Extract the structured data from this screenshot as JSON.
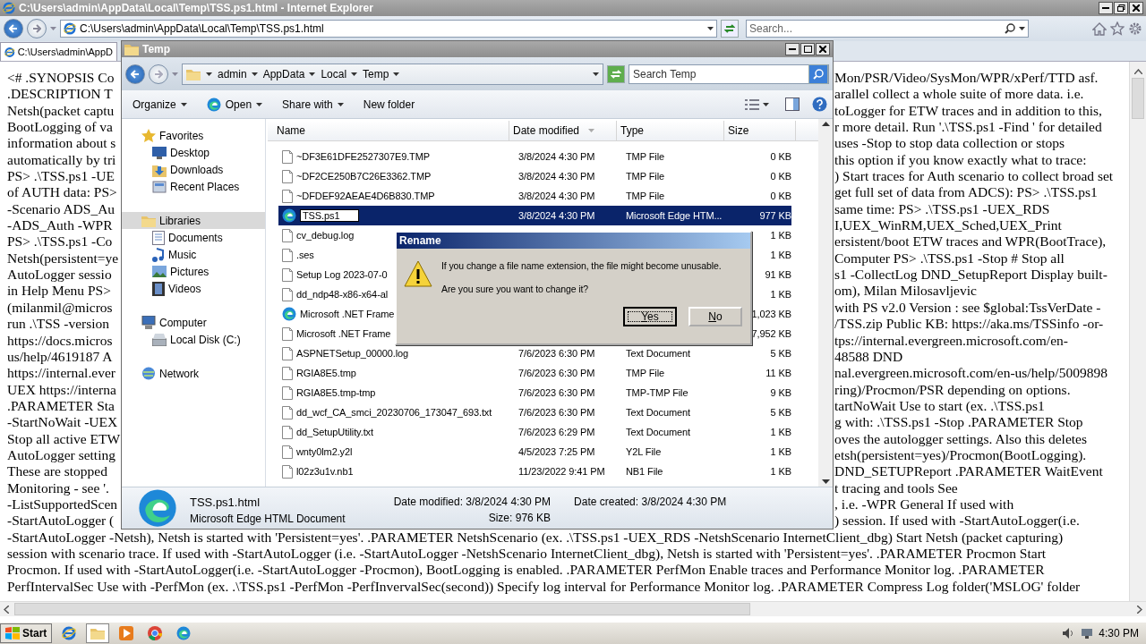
{
  "browser": {
    "title": "C:\\Users\\admin\\AppData\\Local\\Temp\\TSS.ps1.html - Internet Explorer",
    "address": "C:\\Users\\admin\\AppData\\Local\\Temp\\TSS.ps1.html",
    "search": {
      "placeholder": "Search..."
    },
    "tabs": [
      {
        "label": "C:\\Users\\admin\\AppD",
        "selected": true
      }
    ]
  },
  "page_text": {
    "split_lines": [
      {
        "left": "<# .SYNOPSIS Co",
        "right": "Mon/PSR/Video/SysMon/WPR/xPerf/TTD asf."
      },
      {
        "left": ".DESCRIPTION T",
        "right": "arallel collect a whole suite of more data. i.e."
      },
      {
        "left": "Netsh(packet captu",
        "right": "toLogger for ETW traces and in addition to this,"
      },
      {
        "left": "BootLogging of va",
        "right": "r more detail. Run '.\\TSS.ps1 -Find ' for detailed"
      },
      {
        "left": "information about s",
        "right": "uses -Stop to stop data collection or stops"
      },
      {
        "left": "automatically by tri",
        "right": "this option if you know exactly what to trace:"
      },
      {
        "left": "PS> .\\TSS.ps1 -UE",
        "right": ") Start traces for Auth scenario to collect broad set"
      },
      {
        "left": "of AUTH data: PS>",
        "right": "get full set of data from ADCS): PS> .\\TSS.ps1"
      },
      {
        "left": "-Scenario ADS_Au",
        "right": "same time: PS> .\\TSS.ps1 -UEX_RDS"
      },
      {
        "left": "-ADS_Auth -WPR",
        "right": "I,UEX_WinRM,UEX_Sched,UEX_Print"
      },
      {
        "left": "PS> .\\TSS.ps1 -Co",
        "right": "ersistent/boot ETW traces and WPR(BootTrace),"
      },
      {
        "left": "Netsh(persistent=ye",
        "right": "Computer PS> .\\TSS.ps1 -Stop # Stop all"
      },
      {
        "left": "AutoLogger sessio",
        "right": "s1 -CollectLog DND_SetupReport Display built-"
      },
      {
        "left": "in Help Menu PS>",
        "right": "om), Milan Milosavljevic"
      },
      {
        "left": "(milanmil@micros",
        "right": "with PS v2.0 Version : see $global:TssVerDate -"
      },
      {
        "left": "run .\\TSS -version",
        "right": "/TSS.zip Public KB: https://aka.ms/TSSinfo -or-"
      },
      {
        "left": "https://docs.micros",
        "right": "tps://internal.evergreen.microsoft.com/en-"
      },
      {
        "left": "us/help/4619187 A",
        "right": "48588 DND"
      },
      {
        "left": "https://internal.ever",
        "right": "nal.evergreen.microsoft.com/en-us/help/5009898"
      },
      {
        "left": "UEX https://interna",
        "right": "ring)/Procmon/PSR depending on options."
      },
      {
        "left": ".PARAMETER Sta",
        "right": "tartNoWait Use to start (ex. .\\TSS.ps1"
      },
      {
        "left": "-StartNoWait -UEX",
        "right": "g with: .\\TSS.ps1 -Stop .PARAMETER Stop"
      },
      {
        "left": "Stop all active ETW",
        "right": "oves the autologger settings. Also this deletes"
      },
      {
        "left": "AutoLogger setting",
        "right": "etsh(persistent=yes)/Procmon(BootLogging)."
      },
      {
        "left": "These are stopped",
        "right": "DND_SETUPReport .PARAMETER WaitEvent"
      },
      {
        "left": "Monitoring - see '.",
        "right": "t tracing and tools See"
      },
      {
        "left": "-ListSupportedScen",
        "right": ", i.e. -WPR General If used with"
      },
      {
        "left": "-StartAutoLogger (",
        "right": ") session. If used with -StartAutoLogger(i.e."
      }
    ],
    "full_lines": [
      "-StartAutoLogger -Netsh), Netsh is started with 'Persistent=yes'. .PARAMETER NetshScenario (ex. .\\TSS.ps1 -UEX_RDS -NetshScenario InternetClient_dbg) Start Netsh (packet capturing)",
      "session with scenario trace. If used with -StartAutoLogger (i.e. -StartAutoLogger -NetshScenario InternetClient_dbg), Netsh is started with 'Persistent=yes'. .PARAMETER Procmon Start",
      "Procmon. If used with -StartAutoLogger(i.e. -StartAutoLogger -Procmon), BootLogging is enabled. .PARAMETER PerfMon Enable traces and Performance Monitor log. .PARAMETER",
      "PerfIntervalSec Use with -PerfMon (ex. .\\TSS.ps1 -PerfMon -PerfInvervalSec(second)) Specify log interval for Performance Monitor log. .PARAMETER Compress Log folder('MSLOG' folder"
    ]
  },
  "explorer": {
    "title": "Temp",
    "breadcrumb": [
      "admin",
      "AppData",
      "Local",
      "Temp"
    ],
    "search": {
      "placeholder": "Search Temp"
    },
    "toolbar": [
      {
        "label": "Organize",
        "kind": "plain",
        "dropdown": true
      },
      {
        "label": "Open",
        "kind": "app",
        "dropdown": true
      },
      {
        "label": "Share with",
        "kind": "plain",
        "dropdown": true
      },
      {
        "label": "New folder",
        "kind": "plain",
        "dropdown": false
      }
    ],
    "sidebar": [
      {
        "label": "Favorites",
        "kind": "favorites",
        "selected": false,
        "children": [
          {
            "label": "Desktop",
            "kind": "desktop",
            "selected": false
          },
          {
            "label": "Downloads",
            "kind": "downloads",
            "selected": false
          },
          {
            "label": "Recent Places",
            "kind": "recent",
            "selected": false
          }
        ]
      },
      {
        "label": "Libraries",
        "kind": "libraries",
        "selected": true,
        "children": [
          {
            "label": "Documents",
            "kind": "documents",
            "selected": false
          },
          {
            "label": "Music",
            "kind": "music",
            "selected": false
          },
          {
            "label": "Pictures",
            "kind": "pictures",
            "selected": false
          },
          {
            "label": "Videos",
            "kind": "videos",
            "selected": false
          }
        ]
      },
      {
        "label": "Computer",
        "kind": "computer",
        "selected": false,
        "children": [
          {
            "label": "Local Disk (C:)",
            "kind": "disk",
            "selected": false
          }
        ]
      },
      {
        "label": "Network",
        "kind": "network",
        "selected": false
      }
    ],
    "columns": [
      {
        "label": "Name",
        "sorted": false
      },
      {
        "label": "Date modified",
        "sorted": true
      },
      {
        "label": "Type",
        "sorted": false
      },
      {
        "label": "Size",
        "sorted": false
      }
    ],
    "files": [
      {
        "kind": "document",
        "name": "~DF3E61DFE2527307E9.TMP",
        "date": "3/8/2024 4:30 PM",
        "type": "TMP File",
        "size": "0 KB",
        "selected": false,
        "renaming": false
      },
      {
        "kind": "document",
        "name": "~DF2CE250B7C26E3362.TMP",
        "date": "3/8/2024 4:30 PM",
        "type": "TMP File",
        "size": "0 KB",
        "selected": false,
        "renaming": false
      },
      {
        "kind": "document",
        "name": "~DFDEF92AEAE4D6B830.TMP",
        "date": "3/8/2024 4:30 PM",
        "type": "TMP File",
        "size": "0 KB",
        "selected": false,
        "renaming": false
      },
      {
        "kind": "edge",
        "name": "TSS.ps1",
        "date": "3/8/2024 4:30 PM",
        "type": "Microsoft Edge HTM...",
        "size": "977 KB",
        "selected": true,
        "renaming": true
      },
      {
        "kind": "document",
        "name": "cv_debug.log",
        "size": "1 KB",
        "selected": false,
        "renaming": false
      },
      {
        "kind": "document",
        "name": ".ses",
        "size": "1 KB",
        "selected": false,
        "renaming": false
      },
      {
        "kind": "document",
        "name": "Setup Log 2023-07-0",
        "size": "91 KB",
        "selected": false,
        "renaming": false
      },
      {
        "kind": "document",
        "name": "dd_ndp48-x86-x64-al",
        "size": "1 KB",
        "selected": false,
        "renaming": false
      },
      {
        "kind": "edge",
        "name": "Microsoft .NET Frame",
        "size": "1,023 KB",
        "selected": false,
        "renaming": false
      },
      {
        "kind": "document",
        "name": "Microsoft .NET Frame",
        "size": "7,952 KB",
        "selected": false,
        "renaming": false
      },
      {
        "kind": "document",
        "name": "ASPNETSetup_00000.log",
        "date": "7/6/2023 6:30 PM",
        "type": "Text Document",
        "size": "5 KB",
        "selected": false,
        "renaming": false
      },
      {
        "kind": "document",
        "name": "RGIA8E5.tmp",
        "date": "7/6/2023 6:30 PM",
        "type": "TMP File",
        "size": "11 KB",
        "selected": false,
        "renaming": false
      },
      {
        "kind": "document",
        "name": "RGIA8E5.tmp-tmp",
        "date": "7/6/2023 6:30 PM",
        "type": "TMP-TMP File",
        "size": "9 KB",
        "selected": false,
        "renaming": false
      },
      {
        "kind": "document",
        "name": "dd_wcf_CA_smci_20230706_173047_693.txt",
        "date": "7/6/2023 6:30 PM",
        "type": "Text Document",
        "size": "5 KB",
        "selected": false,
        "renaming": false
      },
      {
        "kind": "document",
        "name": "dd_SetupUtility.txt",
        "date": "7/6/2023 6:29 PM",
        "type": "Text Document",
        "size": "1 KB",
        "selected": false,
        "renaming": false
      },
      {
        "kind": "document",
        "name": "wnty0lm2.y2l",
        "date": "4/5/2023 7:25 PM",
        "type": "Y2L File",
        "size": "1 KB",
        "selected": false,
        "renaming": false
      },
      {
        "kind": "document",
        "name": "l02z3u1v.nb1",
        "date": "11/23/2022 9:41 PM",
        "type": "NB1 File",
        "size": "1 KB",
        "selected": false,
        "renaming": false
      }
    ],
    "details": {
      "name": "TSS.ps1.html",
      "type": "Microsoft Edge HTML Document",
      "modified": "Date modified: 3/8/2024 4:30 PM",
      "size": "Size: 976 KB",
      "created": "Date created: 3/8/2024 4:30 PM"
    },
    "dialog": {
      "title": "Rename",
      "message": "If you change a file name extension, the file might become unusable.",
      "question": "Are you sure you want to change it?",
      "buttons": [
        {
          "label": "Yes",
          "focused": true
        },
        {
          "label": "No",
          "focused": false
        }
      ]
    }
  },
  "taskbar": {
    "start": "Start",
    "apps": [
      {
        "kind": "ie"
      },
      {
        "kind": "folder"
      },
      {
        "kind": "media"
      },
      {
        "kind": "chrome"
      },
      {
        "kind": "edge"
      }
    ],
    "clock": "4:30 PM"
  }
}
